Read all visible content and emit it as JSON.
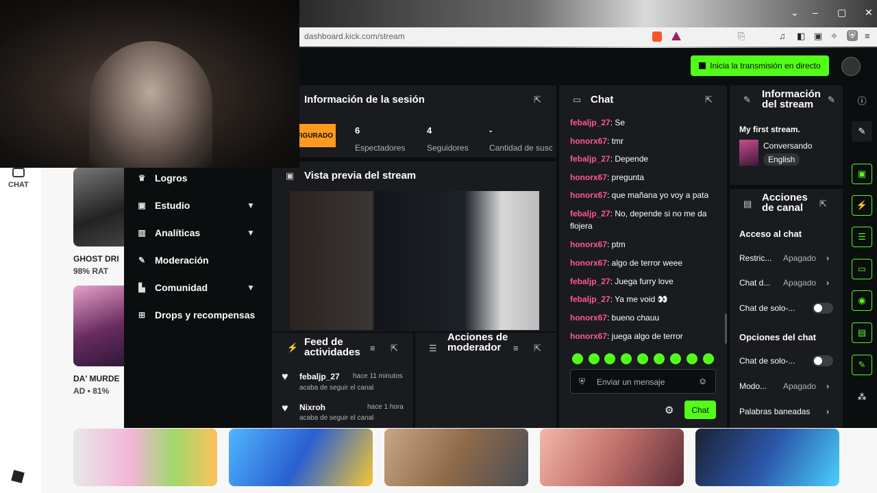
{
  "browser": {
    "url": "dashboard.kick.com/stream"
  },
  "roblox": {
    "chat_label": "CHAT",
    "games": [
      {
        "title": "GHOST DRI",
        "rating": "98% RAT"
      },
      {
        "title": "DA' MURDE",
        "rating": "AD • 81%"
      }
    ]
  },
  "kick": {
    "go_live": "Inicia la transmisión en directo",
    "nav": [
      {
        "label": "Logros"
      },
      {
        "label": "Estudio"
      },
      {
        "label": "Analíticas"
      },
      {
        "label": "Moderación"
      },
      {
        "label": "Comunidad"
      },
      {
        "label": "Drops y recompensas"
      }
    ],
    "session": {
      "title": "Información de la sesión",
      "badge": "FIGURADO",
      "stats": [
        {
          "value": "6",
          "label": "Espectadores"
        },
        {
          "value": "4",
          "label": "Seguidores"
        },
        {
          "value": "-",
          "label": "Cantidad de suscripciones"
        }
      ]
    },
    "preview": {
      "title": "Vista previa del stream"
    },
    "activity": {
      "title": "Feed de actividades",
      "items": [
        {
          "name": "febaljp_27",
          "time": "hace 11 minutos",
          "desc": "acaba de seguir el canal"
        },
        {
          "name": "Nixroh",
          "time": "hace 1 hora",
          "desc": "acaba de seguir el canal"
        }
      ]
    },
    "mod_actions": {
      "title": "Acciones de moderador"
    },
    "chat": {
      "title": "Chat",
      "messages": [
        {
          "user": "febaljp_27",
          "text": ": Se"
        },
        {
          "user": "honorx67",
          "text": ": tmr"
        },
        {
          "user": "febaljp_27",
          "text": ": Depende"
        },
        {
          "user": "honorx67",
          "text": ": pregunta"
        },
        {
          "user": "honorx67",
          "text": ": que mañana yo voy a pata"
        },
        {
          "user": "febaljp_27",
          "text": ": No, depende si no me da flojera"
        },
        {
          "user": "honorx67",
          "text": ": ptm"
        },
        {
          "user": "honorx67",
          "text": ": algo de terror weee"
        },
        {
          "user": "febaljp_27",
          "text": ": Juega furry love"
        },
        {
          "user": "febaljp_27",
          "text": ": Ya me void 👀"
        },
        {
          "user": "honorx67",
          "text": ": bueno chauu"
        },
        {
          "user": "honorx67",
          "text": ": juega algo de terror"
        }
      ],
      "input_placeholder": "Enviar un mensaje",
      "send_label": "Chat"
    },
    "stream_info": {
      "title": "Información del stream",
      "stream_title": "My first stream.",
      "category": "Conversando",
      "language": "English"
    },
    "channel_actions": {
      "title": "Acciones de canal",
      "chat_access": "Acceso al chat",
      "rows1": [
        {
          "label": "Restric...",
          "value": "Apagado"
        },
        {
          "label": "Chat d...",
          "value": "Apagado"
        },
        {
          "label": "Chat de solo-...",
          "value": ""
        }
      ],
      "chat_options": "Opciones del chat",
      "rows2": [
        {
          "label": "Chat de solo-...",
          "value": ""
        },
        {
          "label": "Modo...",
          "value": "Apagado"
        },
        {
          "label": "Palabras baneadas",
          "value": ""
        }
      ]
    }
  }
}
